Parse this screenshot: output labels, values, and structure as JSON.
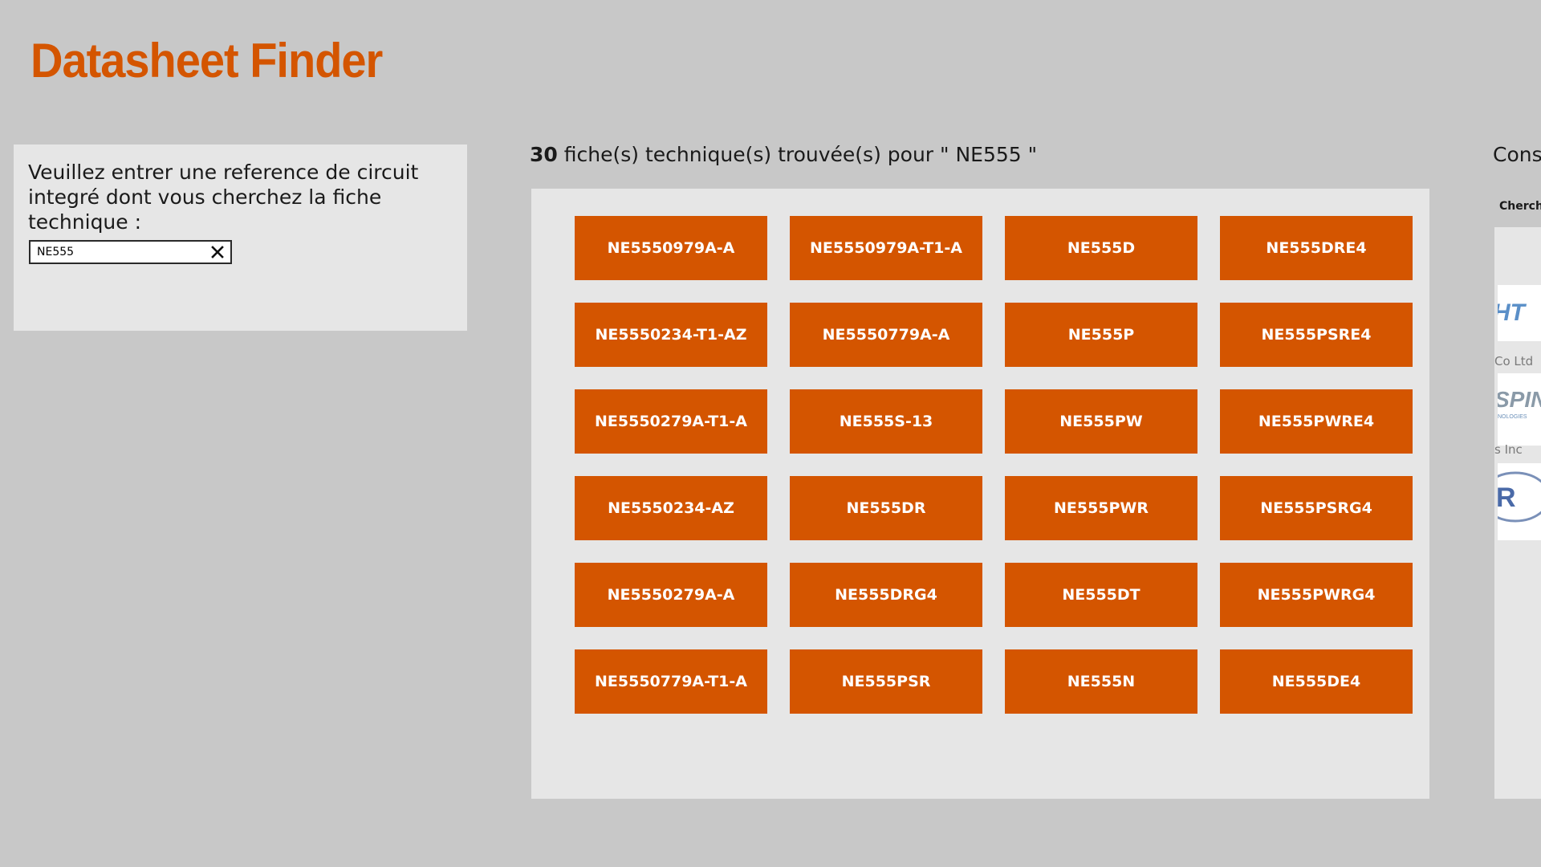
{
  "app": {
    "title": "Datasheet Finder"
  },
  "search": {
    "prompt": "Veuillez entrer une reference de circuit integré dont vous cherchez la fiche technique :",
    "value": "NE555",
    "clear_icon": "close-icon"
  },
  "results": {
    "count": "30",
    "header_text": " fiche(s) technique(s) trouvée(s) pour \" NE555 \"",
    "items": [
      "NE5550979A-A",
      "NE5550979A-T1-A",
      "NE555D",
      "NE555DRE4",
      "NE5550234-T1-AZ",
      "NE5550779A-A",
      "NE555P",
      "NE555PSRE4",
      "NE5550279A-T1-A",
      "NE555S-13",
      "NE555PW",
      "NE555PWRE4",
      "NE5550234-AZ",
      "NE555DR",
      "NE555PWR",
      "NE555PSRG4",
      "NE5550279A-A",
      "NE555DRG4",
      "NE555DT",
      "NE555PWRG4",
      "NE5550779A-T1-A",
      "NE555PSR",
      "NE555N",
      "NE555DE4"
    ]
  },
  "manufacturers": {
    "heading": "Cons",
    "subheading": "Cherche",
    "logos": [
      {
        "text": "HT"
      },
      {
        "text": "SPIN",
        "subtext": "NOLOGIES"
      },
      {
        "text": "R"
      }
    ],
    "makers": [
      "Co Ltd",
      "s Inc"
    ]
  },
  "colors": {
    "accent": "#d45500",
    "background": "#c8c8c8",
    "panel": "#e6e6e6"
  }
}
